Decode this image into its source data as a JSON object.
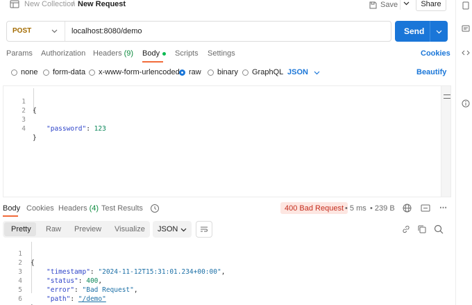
{
  "breadcrumb": {
    "collection": "New Collection",
    "separator": "/",
    "request": "New Request"
  },
  "header": {
    "save_label": "Save",
    "share_label": "Share"
  },
  "request": {
    "method": "POST",
    "url": "localhost:8080/demo",
    "send_label": "Send"
  },
  "request_tabs": {
    "params": "Params",
    "authorization": "Authorization",
    "headers": "Headers",
    "headers_count": "(9)",
    "body": "Body",
    "scripts": "Scripts",
    "settings": "Settings",
    "cookies": "Cookies"
  },
  "body_types": {
    "none": "none",
    "form_data": "form-data",
    "urlencoded": "x-www-form-urlencoded",
    "raw": "raw",
    "binary": "binary",
    "graphql": "GraphQL",
    "format": "JSON",
    "selected": "raw",
    "beautify": "Beautify"
  },
  "request_body": {
    "lines": [
      {
        "n": "1",
        "text": "{"
      },
      {
        "n": "2",
        "text": ""
      },
      {
        "n": "3",
        "key": "\"password\"",
        "sep": ": ",
        "num": "123"
      },
      {
        "n": "4",
        "text": "}"
      }
    ]
  },
  "response_tabs": {
    "body": "Body",
    "cookies": "Cookies",
    "headers": "Headers",
    "headers_count": "(4)",
    "test_results": "Test Results"
  },
  "response_meta": {
    "status": "400 Bad Request",
    "time": "5 ms",
    "size": "239 B"
  },
  "response_view": {
    "pretty": "Pretty",
    "raw": "Raw",
    "preview": "Preview",
    "visualize": "Visualize",
    "format": "JSON"
  },
  "response_body": {
    "lines": [
      {
        "n": "1",
        "text": "{"
      },
      {
        "n": "2",
        "key": "\"timestamp\"",
        "sep": ": ",
        "str": "\"2024-11-12T15:31:01.234+00:00\"",
        "tail": ","
      },
      {
        "n": "3",
        "key": "\"status\"",
        "sep": ": ",
        "num": "400",
        "tail": ","
      },
      {
        "n": "4",
        "key": "\"error\"",
        "sep": ": ",
        "str": "\"Bad Request\"",
        "tail": ","
      },
      {
        "n": "5",
        "key": "\"path\"",
        "sep": ": ",
        "str": "\"/demo\""
      },
      {
        "n": "6",
        "text": "}"
      }
    ]
  },
  "colors": {
    "accent_blue": "#1a76d8",
    "tab_underline": "#f26b3a",
    "method_post": "#a36b00",
    "status_error_bg": "#fde6e1",
    "status_error_text": "#c42d1e",
    "body_dot": "#0cbb52"
  },
  "icons": {
    "collection": "collection-icon",
    "save": "save-icon",
    "history": "history-icon",
    "globe": "globe-icon",
    "copy": "copy-icon",
    "link": "link-icon",
    "search": "search-icon",
    "wrap": "wrap-lines-icon",
    "rail": [
      "docs-icon",
      "comments-icon",
      "code-icon",
      "info-icon"
    ]
  }
}
